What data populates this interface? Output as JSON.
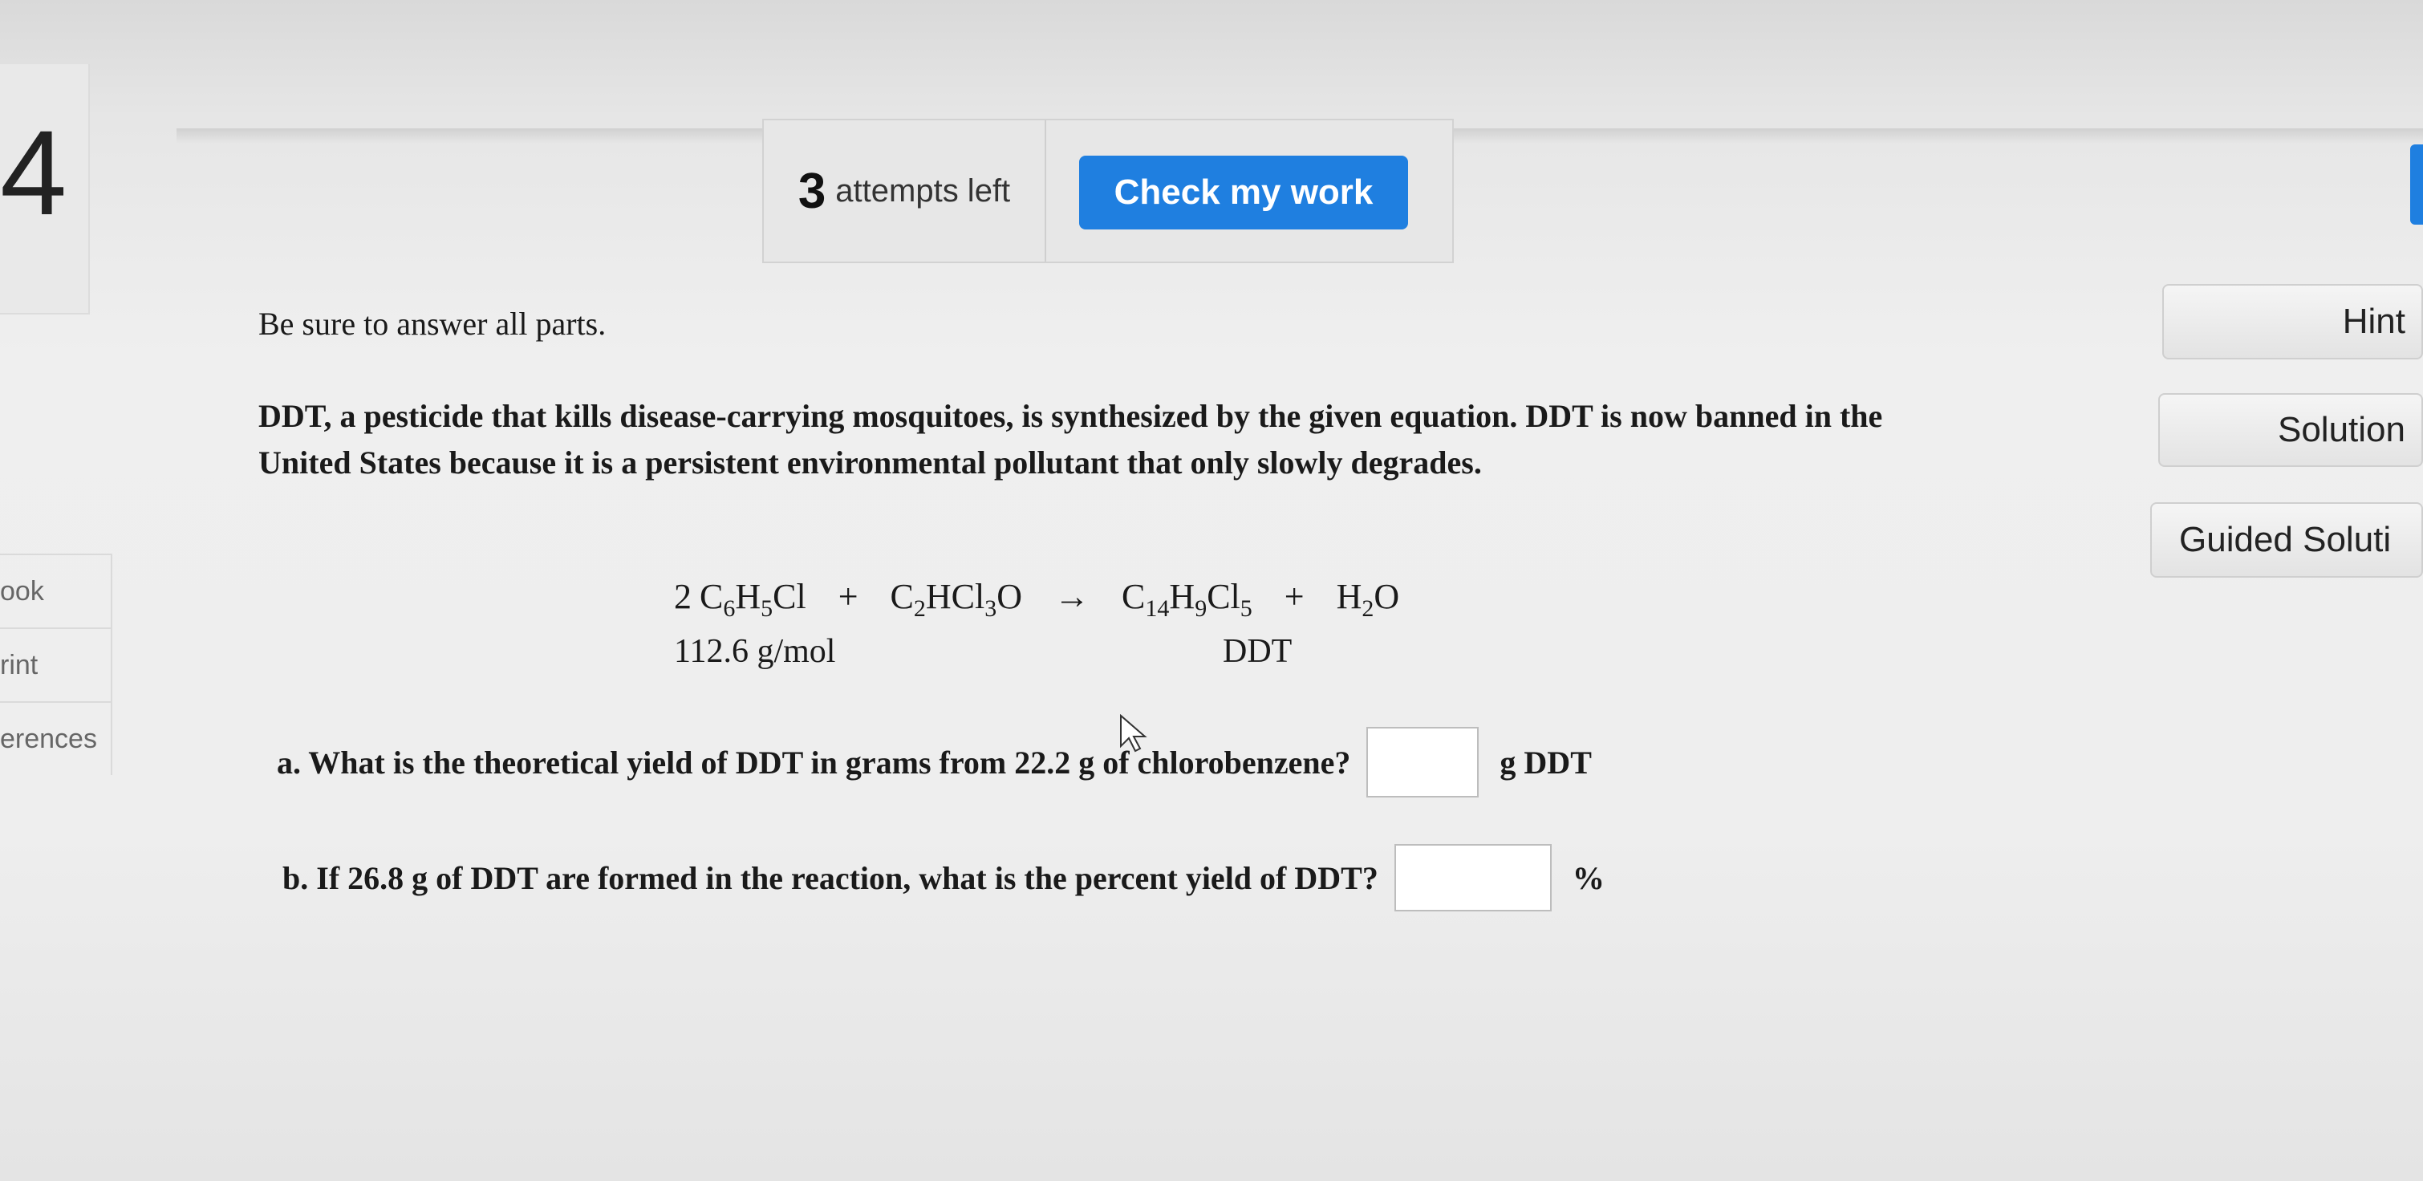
{
  "question_number": "4",
  "left_nav": [
    "ook",
    "rint",
    "erences"
  ],
  "attempts": {
    "count": "3",
    "label": "attempts left"
  },
  "check_button": "Check my work",
  "side_buttons": {
    "hint": "Hint",
    "solution": "Solution",
    "guided": "Guided Soluti"
  },
  "intro": "Be sure to answer all parts.",
  "problem": "DDT, a pesticide that kills disease-carrying mosquitoes, is synthesized by the given equation. DDT is now banned in the United States because it is a persistent environmental pollutant that only slowly degrades.",
  "equation": {
    "r1_coef": "2",
    "r1": "C6H5Cl",
    "plus1": "+",
    "r2": "C2HCl3O",
    "arrow": "→",
    "p1": "C14H9Cl5",
    "plus2": "+",
    "p2": "H2O",
    "r1_label": "112.6 g/mol",
    "p1_label": "DDT"
  },
  "question_a": {
    "text": "a. What is the theoretical yield of DDT in grams from 22.2 g of chlorobenzene?",
    "unit": "g DDT",
    "value": ""
  },
  "question_b": {
    "text": "b. If 26.8 g of DDT are formed in the reaction, what is the percent yield of DDT?",
    "unit": "%",
    "value": ""
  },
  "accent_color": "#1f7fe0"
}
